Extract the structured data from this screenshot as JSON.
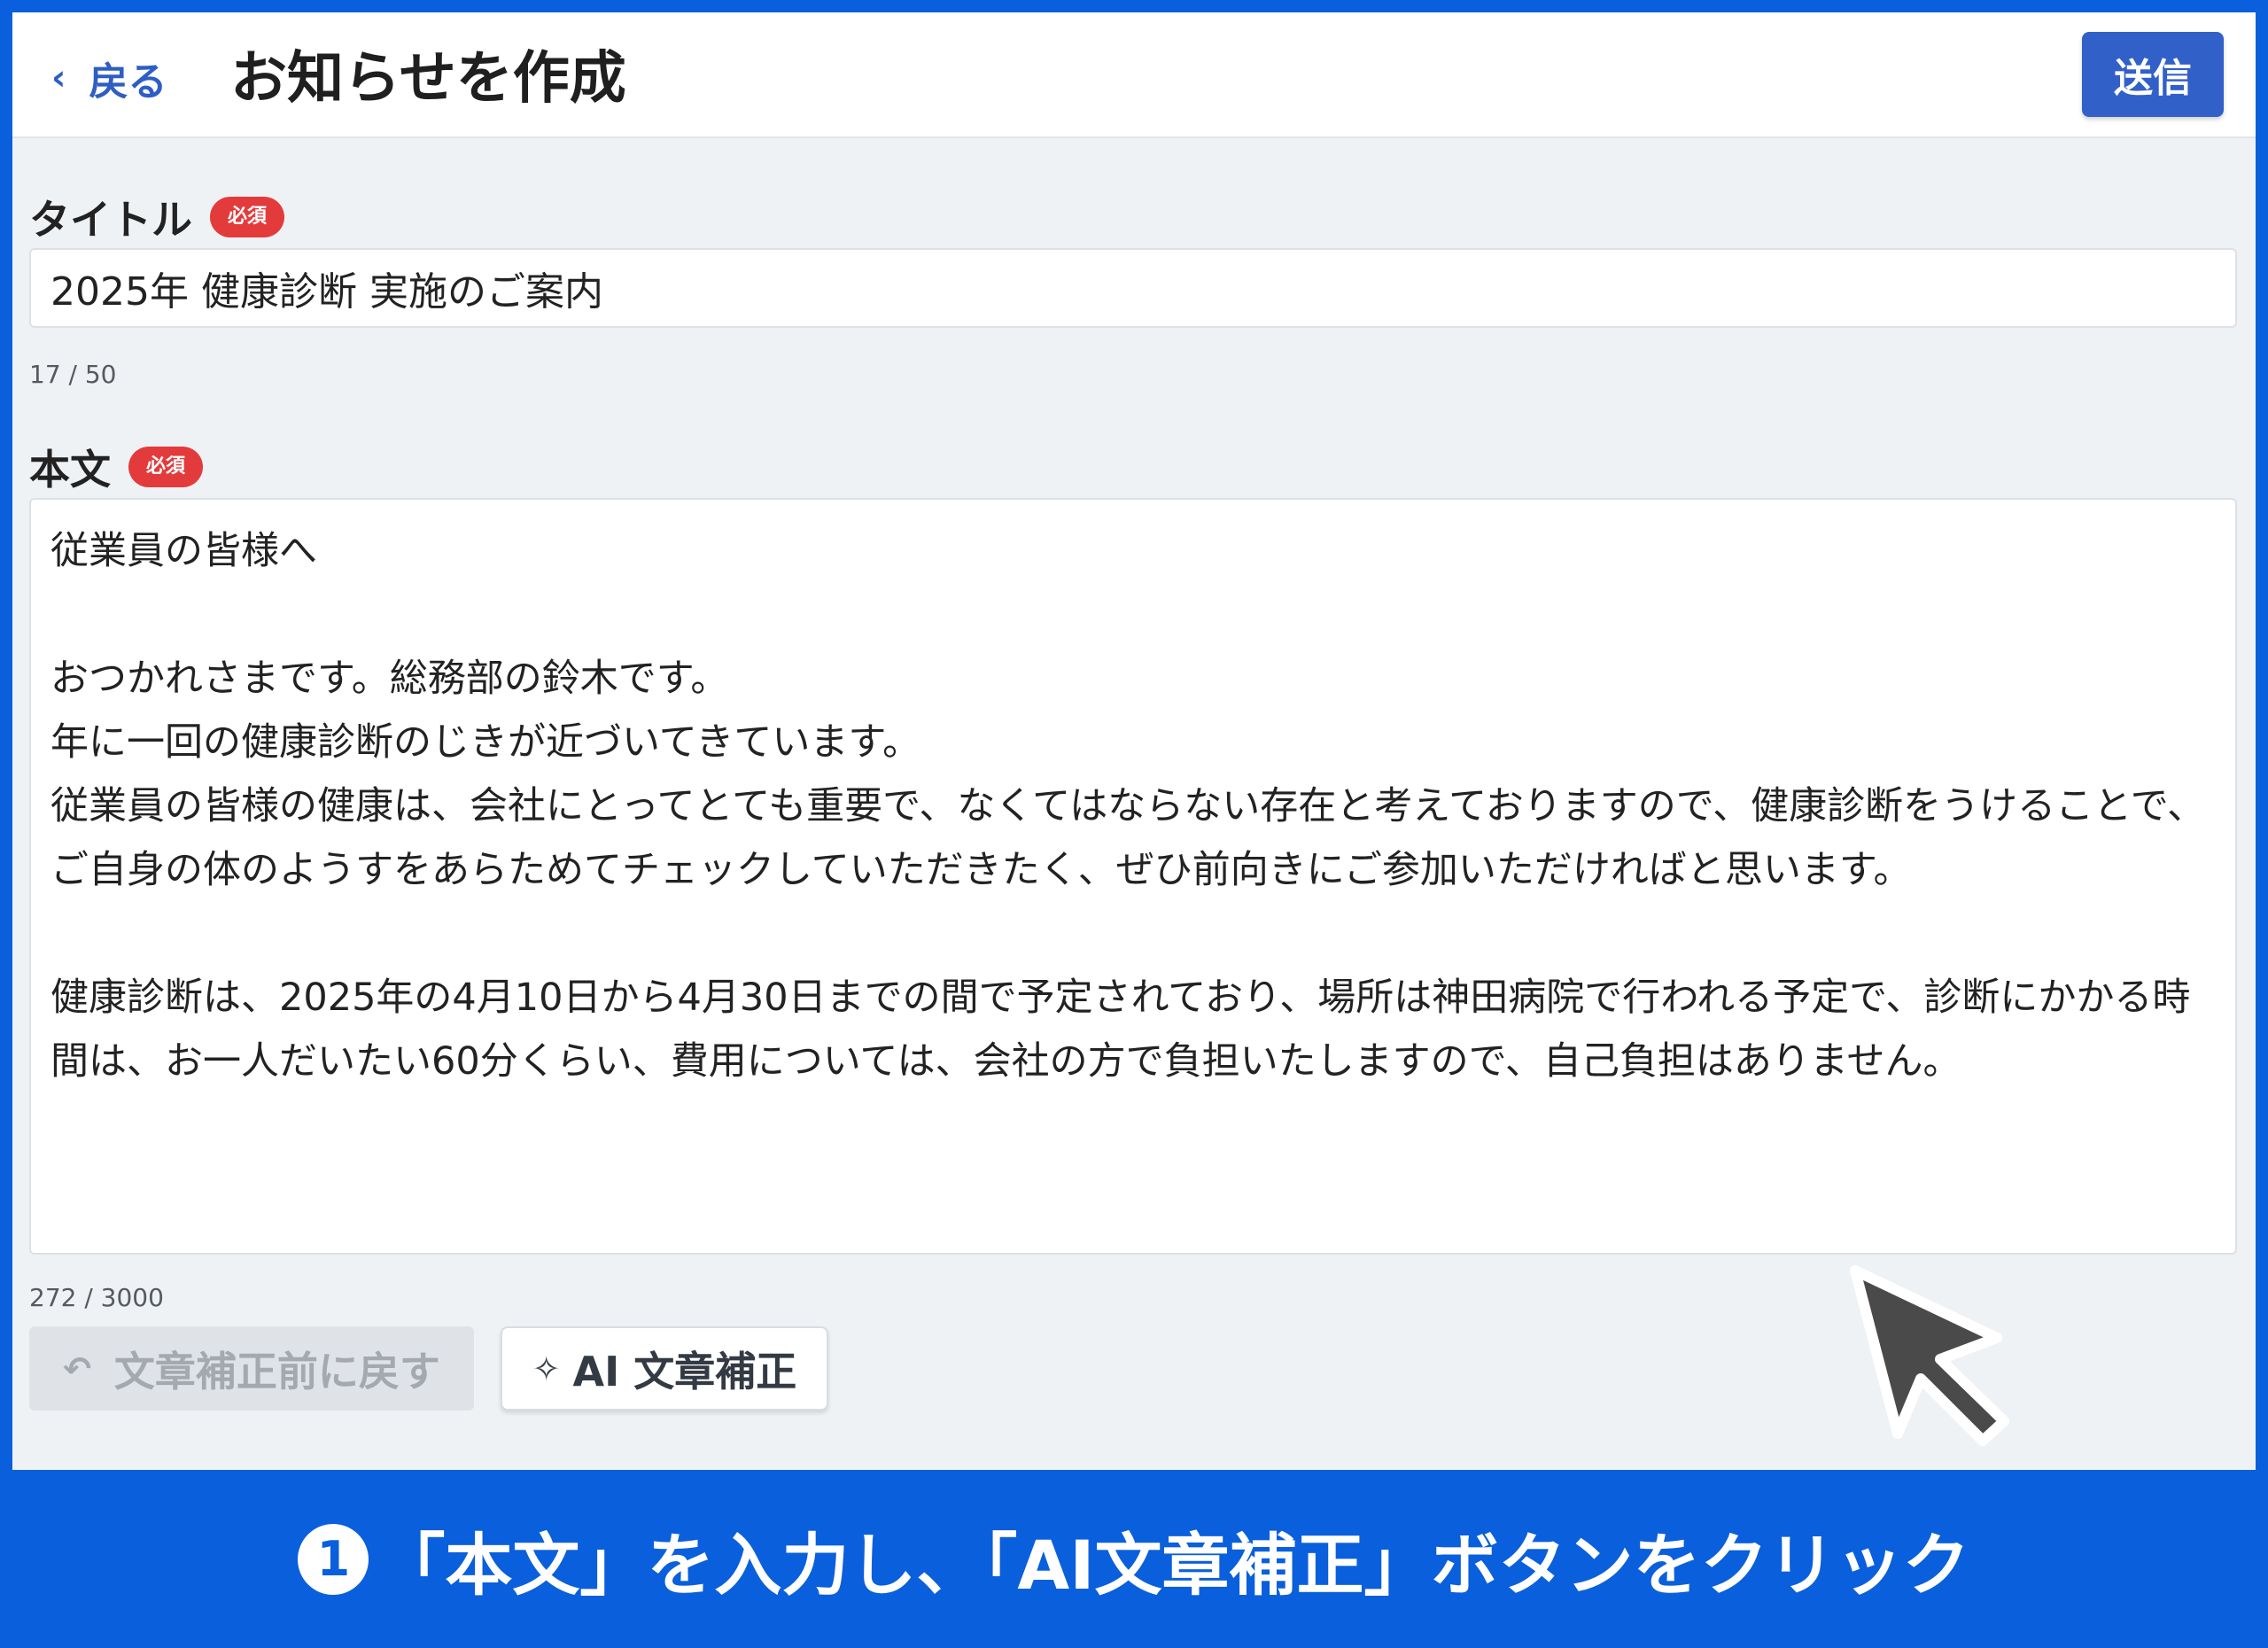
{
  "header": {
    "back_icon": "chevron-left-icon",
    "back_label": "戻る",
    "title": "お知らせを作成",
    "send_label": "送信"
  },
  "form": {
    "title_field": {
      "label": "タイトル",
      "badge": "必須",
      "value": "2025年 健康診断 実施のご案内",
      "counter": "17 / 50"
    },
    "body_field": {
      "label": "本文",
      "badge": "必須",
      "value": "従業員の皆様へ\n\nおつかれさまです。総務部の鈴木です。\n年に一回の健康診断のじきが近づいてきています。\n従業員の皆様の健康は、会社にとってとても重要で、なくてはならない存在と考えておりますので、健康診断をうけることで、ご自身の体のようすをあらためてチェックしていただきたく、ぜひ前向きにご参加いただければと思います。\n\n健康診断は、2025年の4月10日から4月30日までの間で予定されており、場所は神田病院で行われる予定で、診断にかかる時間は、お一人だいたい60分くらい、費用については、会社の方で負担いたしますので、自己負担はありません。",
      "counter": "272 / 3000"
    },
    "revert_button": {
      "label": "文章補正前に戻す",
      "icon": "undo-icon"
    },
    "ai_button": {
      "label": "AI 文章補正",
      "icon": "sparkle-icon"
    }
  },
  "caption": {
    "step_number": "1",
    "text": "「本文」を入力し、「AI文章補正」ボタンをクリック"
  },
  "colors": {
    "accent": "#3160c8",
    "caption_bg": "#0a5fdc",
    "required_badge": "#e33b3b",
    "background": "#eff2f5"
  }
}
